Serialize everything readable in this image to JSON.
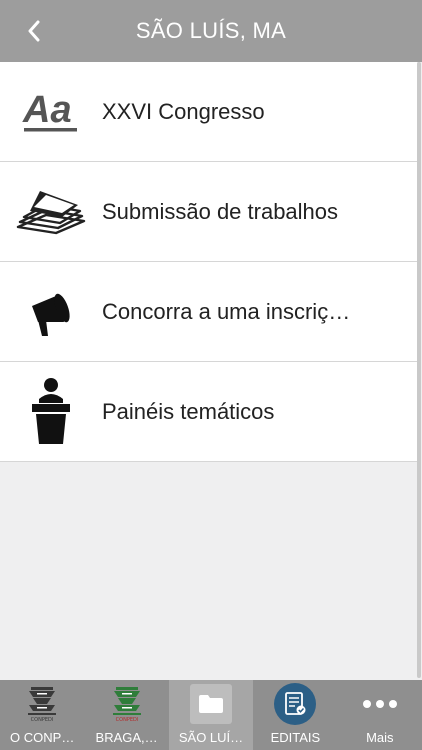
{
  "header": {
    "title": "SÃO LUÍS, MA",
    "back_icon": "chevron-left-icon"
  },
  "list": {
    "items": [
      {
        "label": "XXVI Congresso",
        "icon": "typography-icon"
      },
      {
        "label": "Submissão de trabalhos",
        "icon": "papers-stack-icon"
      },
      {
        "label": "Concorra a uma inscriç…",
        "icon": "megaphone-icon"
      },
      {
        "label": "Painéis temáticos",
        "icon": "speaker-podium-icon"
      }
    ]
  },
  "tabbar": {
    "tabs": [
      {
        "label": "O CONP…",
        "icon": "conpedi-logo-icon",
        "active": false
      },
      {
        "label": "BRAGA,…",
        "icon": "conpedi-green-logo-icon",
        "active": false
      },
      {
        "label": "SÃO LUÍ…",
        "icon": "folder-icon",
        "active": true
      },
      {
        "label": "EDITAIS",
        "icon": "document-check-icon",
        "active": false
      },
      {
        "label": "Mais",
        "icon": "more-dots-icon",
        "active": false
      }
    ]
  },
  "colors": {
    "header_bg": "#9d9d9d",
    "tabbar_bg": "#8f8f8f",
    "active_tab_bg": "#a6a6a6",
    "editais_circle": "#2c5f86",
    "list_bg": "#ffffff",
    "page_bg": "#efeff0"
  }
}
